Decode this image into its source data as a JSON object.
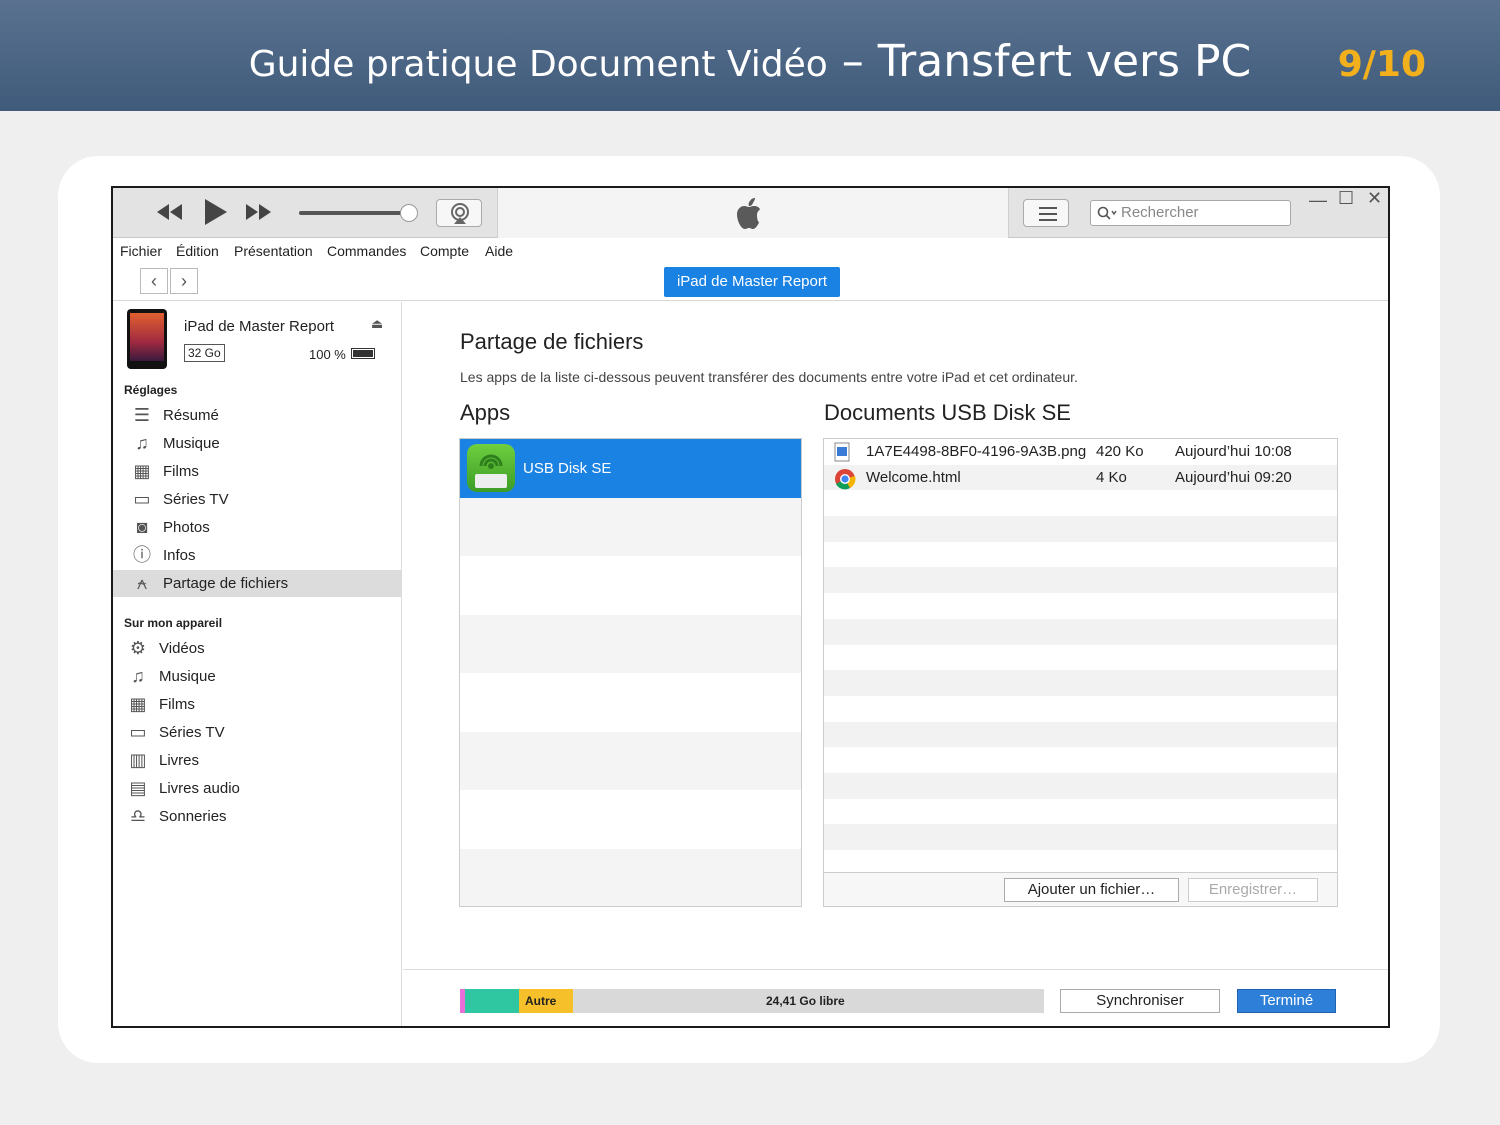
{
  "slide": {
    "title_main": "Guide pratique Document Vidéo",
    "title_sep": " – ",
    "title_sub": "Transfert vers PC",
    "page": "9/10"
  },
  "toolbar": {
    "search_placeholder": "Rechercher"
  },
  "menu": [
    "Fichier",
    "Édition",
    "Présentation",
    "Commandes",
    "Compte",
    "Aide"
  ],
  "nav": {
    "device_button": "iPad de Master Report"
  },
  "device": {
    "name": "iPad de Master Report",
    "capacity": "32 Go",
    "battery": "100 %"
  },
  "sidebar": {
    "settings_title": "Réglages",
    "settings_items": [
      {
        "label": "Résumé",
        "icon": "summary-icon"
      },
      {
        "label": "Musique",
        "icon": "music-icon"
      },
      {
        "label": "Films",
        "icon": "film-icon"
      },
      {
        "label": "Séries TV",
        "icon": "tv-icon"
      },
      {
        "label": "Photos",
        "icon": "camera-icon"
      },
      {
        "label": "Infos",
        "icon": "info-icon"
      },
      {
        "label": "Partage de fichiers",
        "icon": "apps-icon"
      }
    ],
    "device_title": "Sur mon appareil",
    "device_items": [
      {
        "label": "Vidéos",
        "icon": "gear-icon"
      },
      {
        "label": "Musique",
        "icon": "music-icon"
      },
      {
        "label": "Films",
        "icon": "film-icon"
      },
      {
        "label": "Séries TV",
        "icon": "tv-icon"
      },
      {
        "label": "Livres",
        "icon": "book-icon"
      },
      {
        "label": "Livres audio",
        "icon": "audiobook-icon"
      },
      {
        "label": "Sonneries",
        "icon": "bell-icon"
      }
    ]
  },
  "main": {
    "title": "Partage de fichiers",
    "description": "Les apps de la liste ci-dessous peuvent transférer des documents entre votre iPad et cet ordinateur.",
    "apps_title": "Apps",
    "docs_title": "Documents USB Disk SE",
    "apps": [
      {
        "name": "USB Disk SE"
      }
    ],
    "documents": [
      {
        "name": "1A7E4498-8BF0-4196-9A3B.png",
        "size": "420 Ko",
        "date": "Aujourd’hui 10:08",
        "icon": "image-file-icon"
      },
      {
        "name": "Welcome.html",
        "size": "4 Ko",
        "date": "Aujourd’hui 09:20",
        "icon": "chrome-icon"
      }
    ],
    "add_file": "Ajouter un fichier…",
    "save": "Enregistrer…"
  },
  "storage": {
    "other_label": "Autre",
    "free_label": "24,41 Go libre",
    "colors": {
      "pink": "#e96fd8",
      "teal": "#2fc7a2",
      "yellow": "#f5c02a"
    }
  },
  "buttons": {
    "sync": "Synchroniser",
    "done": "Terminé"
  }
}
